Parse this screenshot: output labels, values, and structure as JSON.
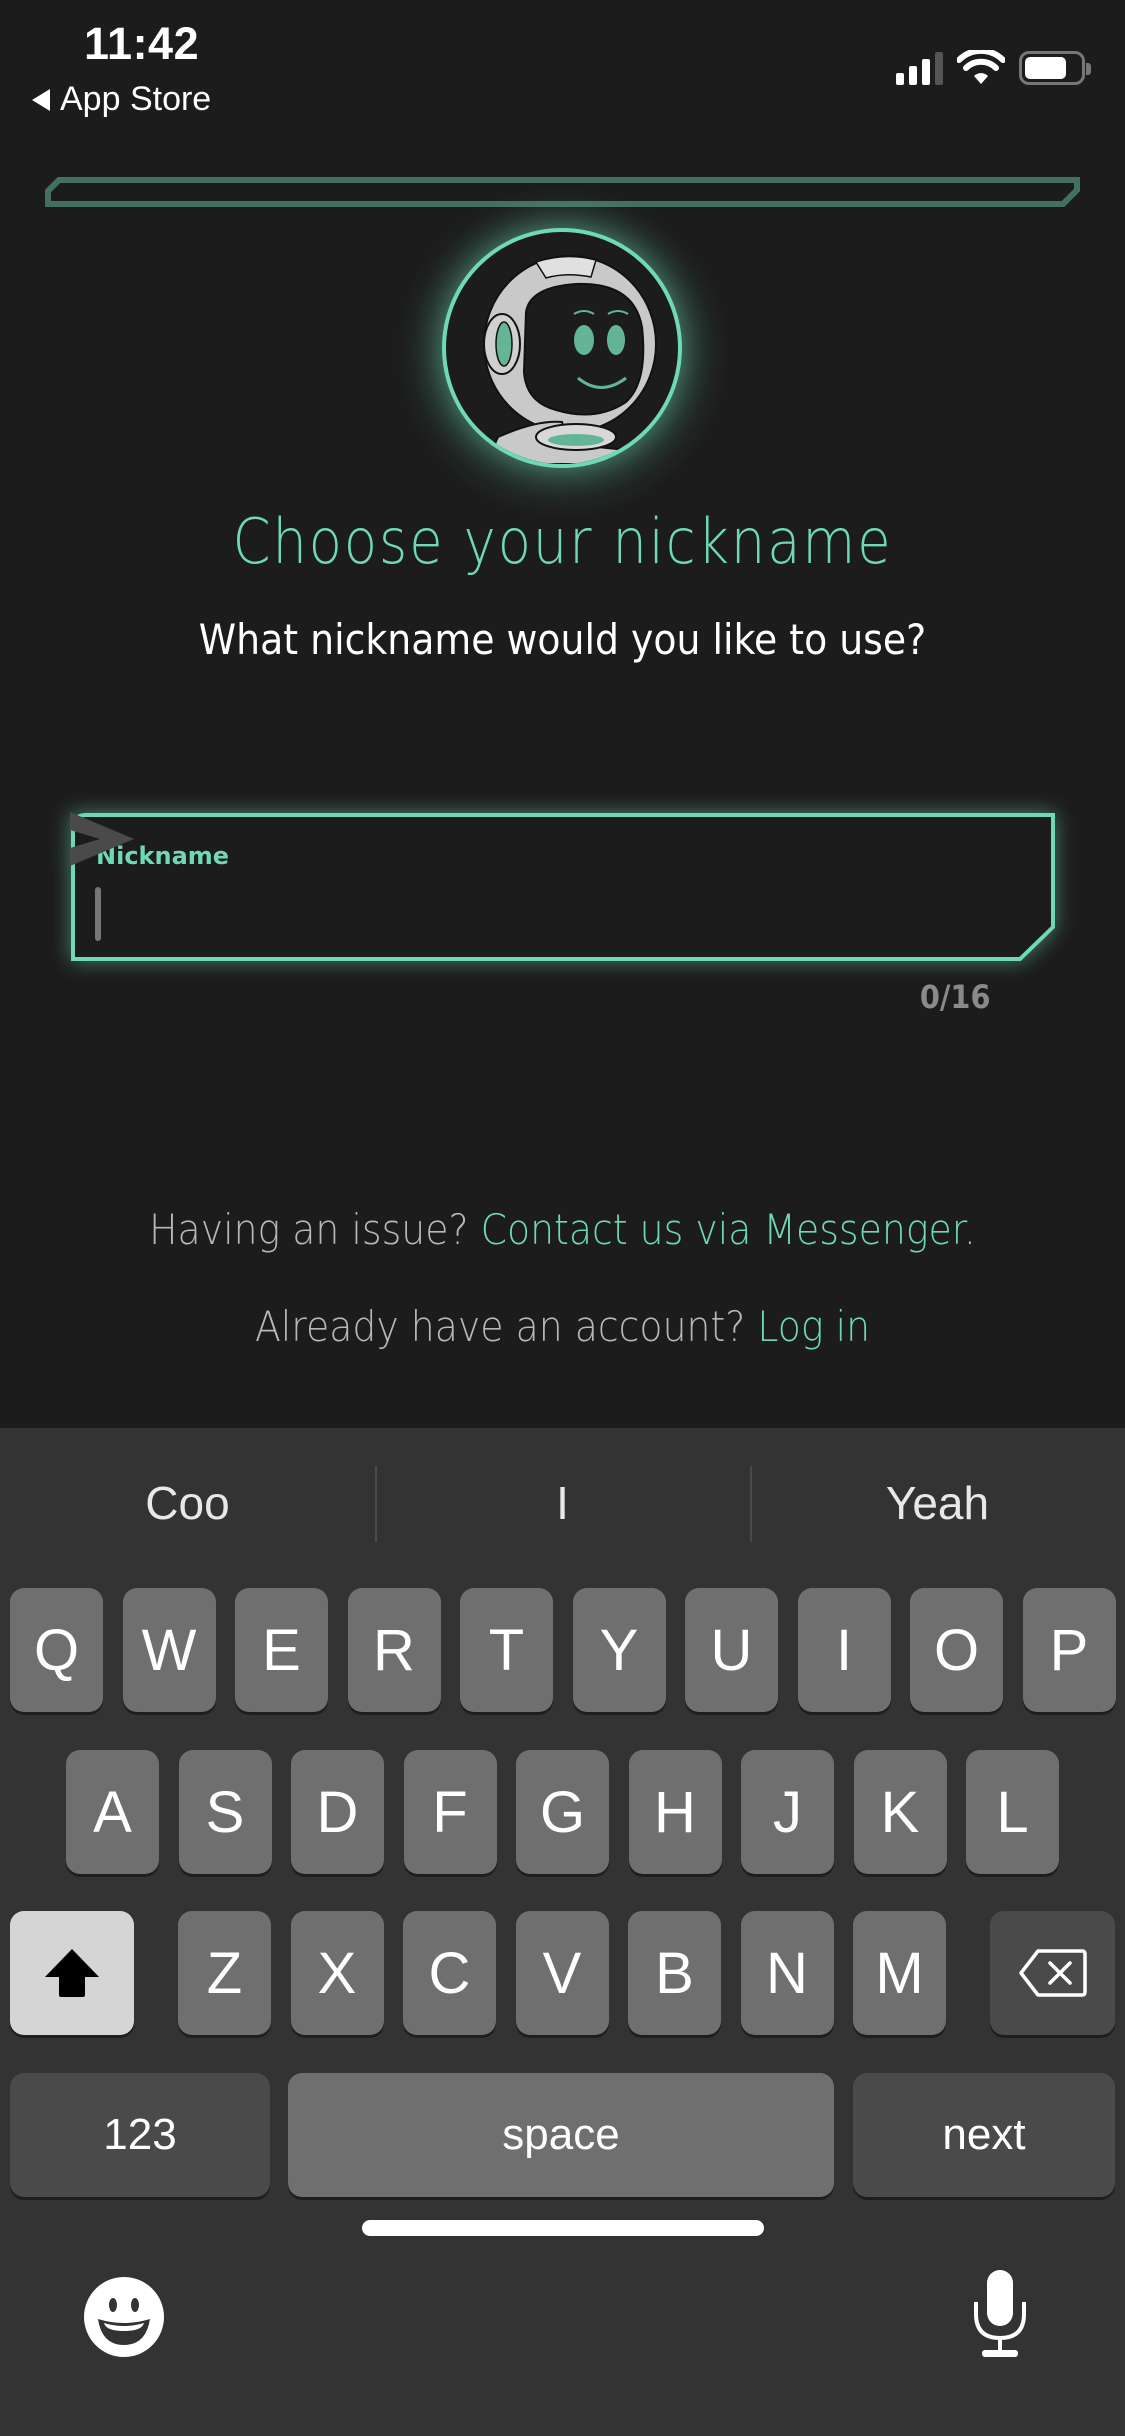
{
  "status_bar": {
    "time": "11:42",
    "back_label": "App Store",
    "signal_bars_active": 3,
    "signal_bars_total": 4,
    "battery_level_percent": 75,
    "icons": [
      "back-arrow-icon",
      "signal-icon",
      "wifi-icon",
      "battery-icon"
    ]
  },
  "progress": {
    "value_percent": 0
  },
  "colors": {
    "accent": "#6ed9b2",
    "background": "#1c1c1c",
    "progress_border": "#437060",
    "muted_text": "#b8b8b8"
  },
  "header": {
    "title": "Choose your nickname",
    "subtitle": "What nickname would you like to use?"
  },
  "nickname_input": {
    "label": "Nickname",
    "value": "",
    "placeholder": "",
    "counter": "0/16",
    "send_icon": "send-icon"
  },
  "footer": {
    "issue_text": "Having an issue? ",
    "issue_link": "Contact us via Messenger.",
    "account_text": "Already have an account? ",
    "login_link": "Log in"
  },
  "keyboard": {
    "suggestions": [
      "Coo",
      "I",
      "Yeah"
    ],
    "row1": [
      "Q",
      "W",
      "E",
      "R",
      "T",
      "Y",
      "U",
      "I",
      "O",
      "P"
    ],
    "row2": [
      "A",
      "S",
      "D",
      "F",
      "G",
      "H",
      "J",
      "K",
      "L"
    ],
    "row3": [
      "Z",
      "X",
      "C",
      "V",
      "B",
      "N",
      "M"
    ],
    "numbers_label": "123",
    "space_label": "space",
    "return_label": "next",
    "shift_icon": "shift-icon",
    "backspace_icon": "backspace-icon",
    "emoji_icon": "emoji-icon",
    "mic_icon": "microphone-icon"
  }
}
